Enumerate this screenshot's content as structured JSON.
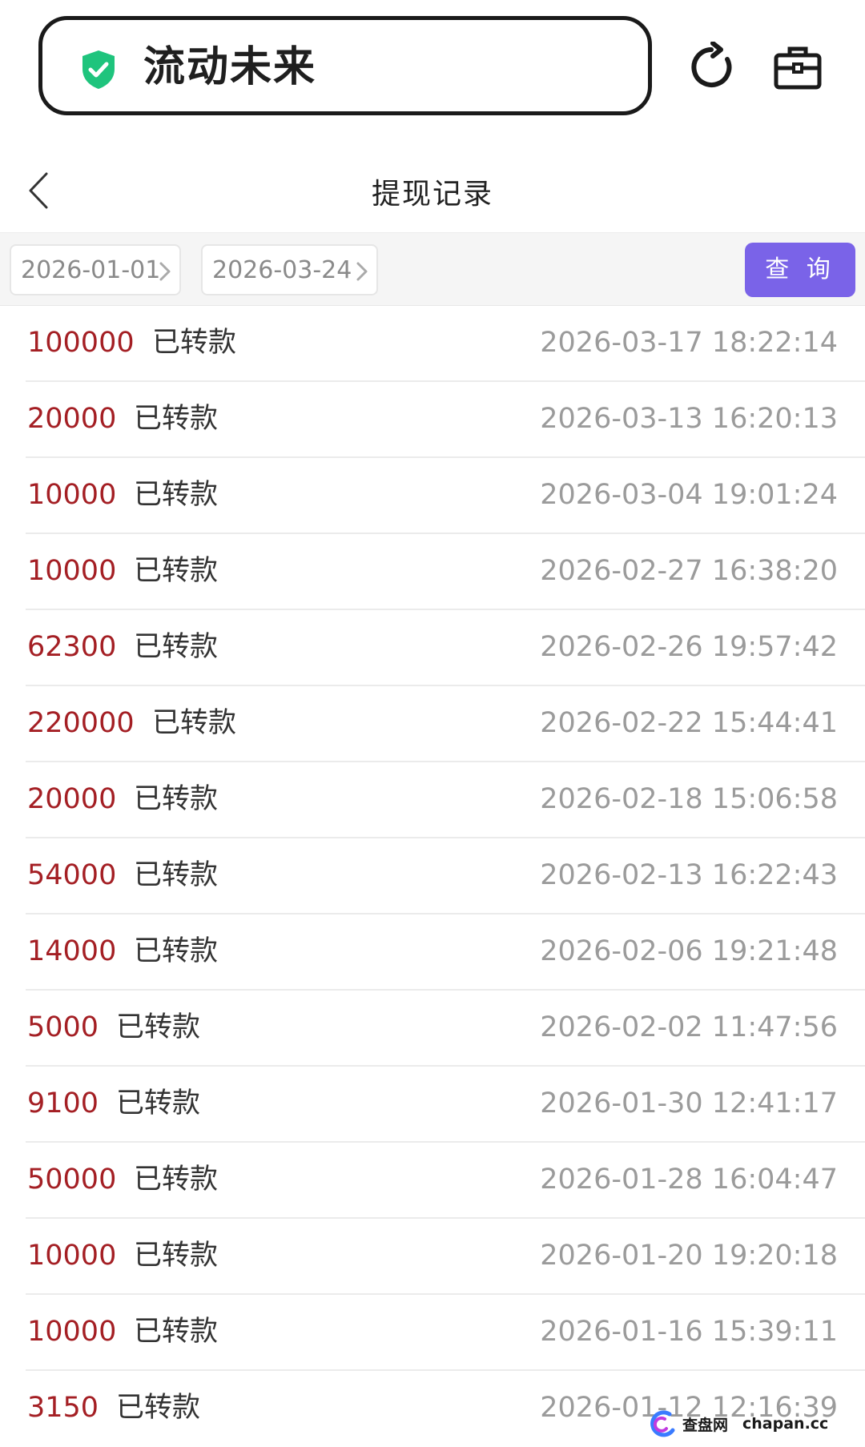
{
  "app": {
    "name": "流动未来",
    "shield_color": "#1fc47d"
  },
  "header": {
    "title": "提现记录"
  },
  "filter": {
    "start_date": "2026-01-01",
    "end_date": "2026-03-24",
    "query_label": "查 询",
    "query_color": "#7a63e8"
  },
  "records": [
    {
      "amount": "100000",
      "status": "已转款",
      "time": "2026-03-17 18:22:14"
    },
    {
      "amount": "20000",
      "status": "已转款",
      "time": "2026-03-13 16:20:13"
    },
    {
      "amount": "10000",
      "status": "已转款",
      "time": "2026-03-04 19:01:24"
    },
    {
      "amount": "10000",
      "status": "已转款",
      "time": "2026-02-27 16:38:20"
    },
    {
      "amount": "62300",
      "status": "已转款",
      "time": "2026-02-26 19:57:42"
    },
    {
      "amount": "220000",
      "status": "已转款",
      "time": "2026-02-22 15:44:41"
    },
    {
      "amount": "20000",
      "status": "已转款",
      "time": "2026-02-18 15:06:58"
    },
    {
      "amount": "54000",
      "status": "已转款",
      "time": "2026-02-13 16:22:43"
    },
    {
      "amount": "14000",
      "status": "已转款",
      "time": "2026-02-06 19:21:48"
    },
    {
      "amount": "5000",
      "status": "已转款",
      "time": "2026-02-02 11:47:56"
    },
    {
      "amount": "9100",
      "status": "已转款",
      "time": "2026-01-30 12:41:17"
    },
    {
      "amount": "50000",
      "status": "已转款",
      "time": "2026-01-28 16:04:47"
    },
    {
      "amount": "10000",
      "status": "已转款",
      "time": "2026-01-20 19:20:18"
    },
    {
      "amount": "10000",
      "status": "已转款",
      "time": "2026-01-16 15:39:11"
    },
    {
      "amount": "3150",
      "status": "已转款",
      "time": "2026-01-12 12:16:39"
    }
  ],
  "colors": {
    "amount": "#a41f24",
    "status": "#333333",
    "time": "#9b9b9b"
  },
  "watermark": {
    "site_cn": "查盘网",
    "site_en": "chapan.cc"
  }
}
